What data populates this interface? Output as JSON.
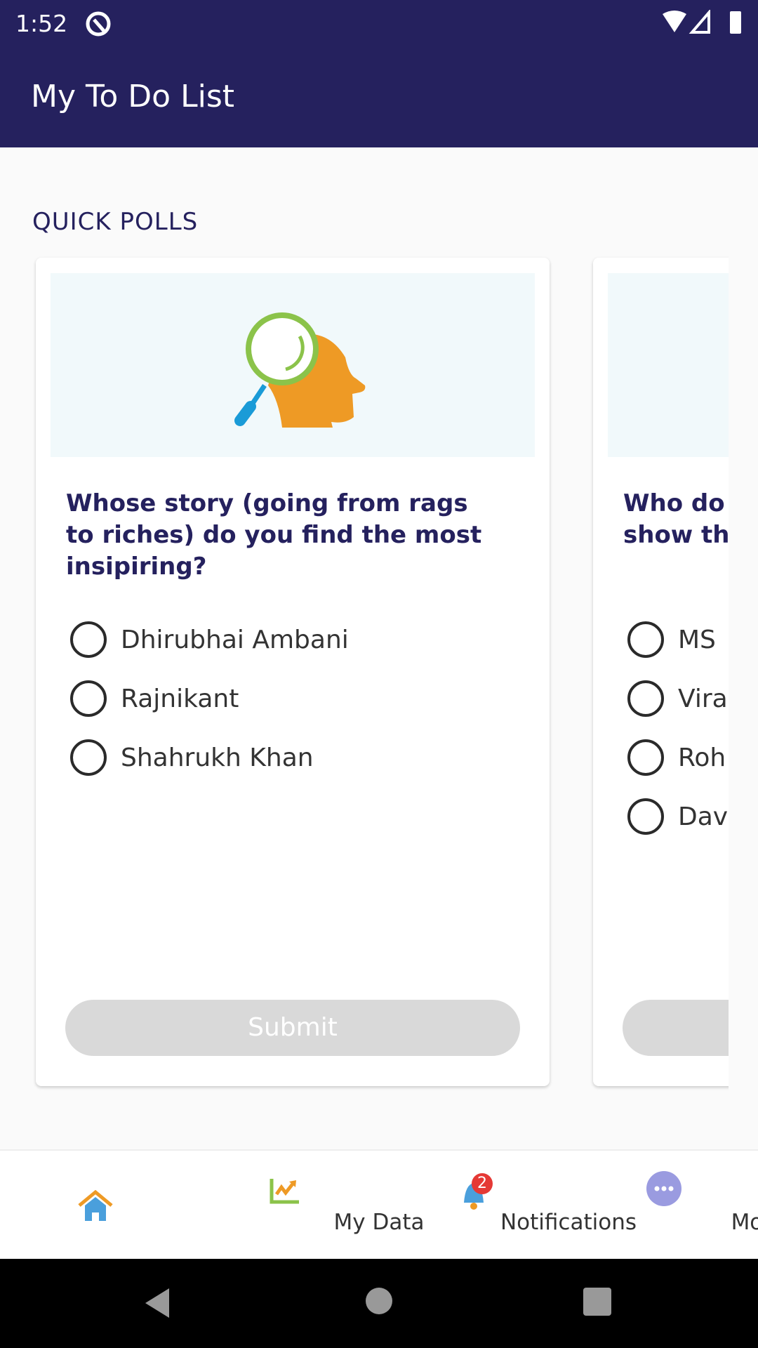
{
  "status_bar": {
    "time": "1:52"
  },
  "app_bar": {
    "title": "My To Do List"
  },
  "section_title": "QUICK POLLS",
  "polls": [
    {
      "question": "Whose story (going from rags to riches) do you find the most insipiring?",
      "options": [
        "Dhirubhai Ambani",
        "Rajnikant",
        "Shahrukh Khan"
      ],
      "submit_label": "Submit"
    },
    {
      "question": "Who do has show the last",
      "options": [
        "MS",
        "Vira",
        "Roh",
        "Dav"
      ]
    }
  ],
  "bottom_nav": {
    "items": [
      {
        "label": "",
        "icon": "home-icon"
      },
      {
        "label": "My Data",
        "icon": "chart-icon"
      },
      {
        "label": "Notifications",
        "icon": "bell-icon",
        "badge": "2"
      },
      {
        "label": "More",
        "icon": "more-icon"
      }
    ]
  },
  "colors": {
    "primary": "#25215e",
    "orange": "#ee9a25",
    "green": "#8bc34a",
    "blue": "#1a9bd7"
  }
}
